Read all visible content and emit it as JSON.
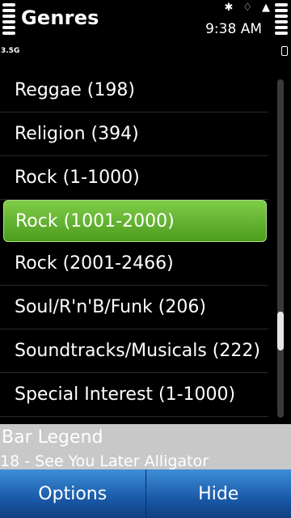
{
  "header": {
    "title": "Genres",
    "time": "9:38 AM",
    "network": "3.5G",
    "icons": [
      "bluetooth-icon",
      "alarm-icon",
      "signal-lock-icon"
    ]
  },
  "list": {
    "items": [
      {
        "label": "Reggae (198)"
      },
      {
        "label": "Religion (394)"
      },
      {
        "label": "Rock (1-1000)"
      },
      {
        "label": "Rock (1001-2000)",
        "selected": true
      },
      {
        "label": "Rock (2001-2466)"
      },
      {
        "label": "Soul/R'n'B/Funk (206)"
      },
      {
        "label": "Soundtracks/Musicals (222)"
      },
      {
        "label": "Special Interest (1-1000)"
      }
    ],
    "scroll_position_fraction": 0.75
  },
  "now_playing": {
    "station": "Bar Legend",
    "track": "18 - See You Later Alligator"
  },
  "softkeys": {
    "left": "Options",
    "right": "Hide"
  },
  "colors": {
    "selected": "#5cb22e",
    "softkey": "#2a6fc0",
    "now_playing_bg": "#c8c8c8"
  }
}
